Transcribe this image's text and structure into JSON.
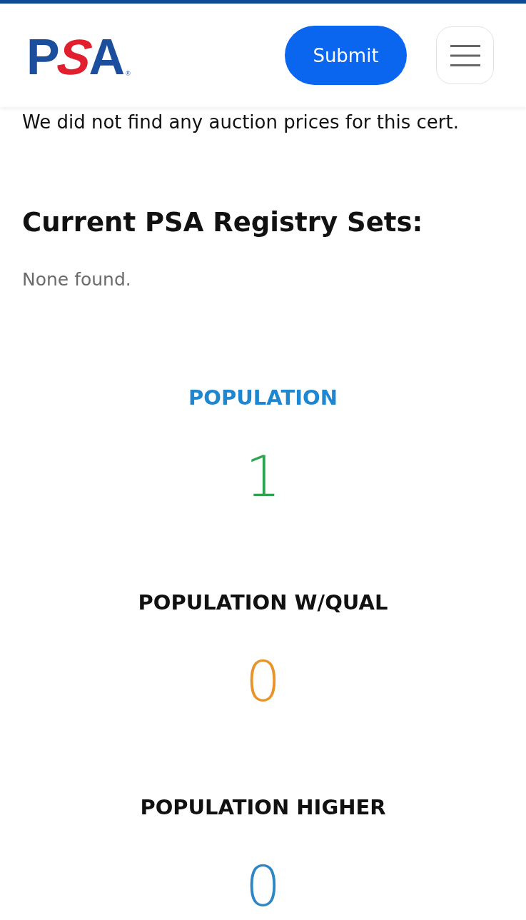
{
  "header": {
    "logo": {
      "letters": [
        {
          "text": "P",
          "color": "#1b4f9d"
        },
        {
          "text": "S",
          "color": "#e21f2f"
        },
        {
          "text": "A",
          "color": "#1b4f9d"
        }
      ],
      "mark": "®"
    },
    "submit_button": "Submit"
  },
  "auction_message": "We did not find any auction prices for this cert.",
  "registry": {
    "heading": "Current PSA Registry Sets:",
    "empty_text": "None found."
  },
  "stats": [
    {
      "label": "POPULATION",
      "kind": "link",
      "value": "1",
      "color": "#2ea44f"
    },
    {
      "label": "POPULATION W/QUAL",
      "kind": "plain",
      "value": "0",
      "color": "#e8942b"
    },
    {
      "label": "POPULATION HIGHER",
      "kind": "plain",
      "value": "0",
      "color": "#2d86c6"
    }
  ]
}
